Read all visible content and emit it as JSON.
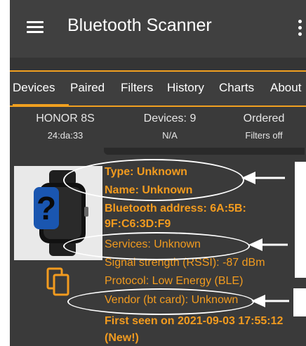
{
  "app": {
    "title": "Bluetooth Scanner"
  },
  "tabs": [
    {
      "label": "Devices",
      "active": true
    },
    {
      "label": "Paired"
    },
    {
      "label": "Filters"
    },
    {
      "label": "History"
    },
    {
      "label": "Charts"
    },
    {
      "label": "About"
    }
  ],
  "status": {
    "device_name": "HONOR 8S",
    "device_addr": "24:da:33",
    "devices_count": "Devices: 9",
    "devices_sub": "N/A",
    "ordered": "Ordered",
    "filters": "Filters off"
  },
  "device": {
    "type": "Type: Unknown",
    "name": "Name: Unknown",
    "address_line1": "Bluetooth address: 6A:5B:",
    "address_line2": "9F:C6:3D:F9",
    "services": "Services: Unknown",
    "signal": "Signal strength (RSSI): -87 dBm",
    "protocol": "Protocol: Low Energy (BLE)",
    "vendor": "Vendor (bt card): Unknown",
    "first_seen": "First seen on 2021-09-03 17:55:12",
    "new_badge": "(New!)"
  },
  "colors": {
    "accent": "#f29b1f",
    "background": "#3a3a3a",
    "appbar": "#404040",
    "annotation": "#ffffff"
  },
  "icons": [
    "menu-icon",
    "overflow-menu-icon",
    "smartwatch-unknown-icon",
    "copy-icon",
    "annotation-arrow-icon"
  ]
}
